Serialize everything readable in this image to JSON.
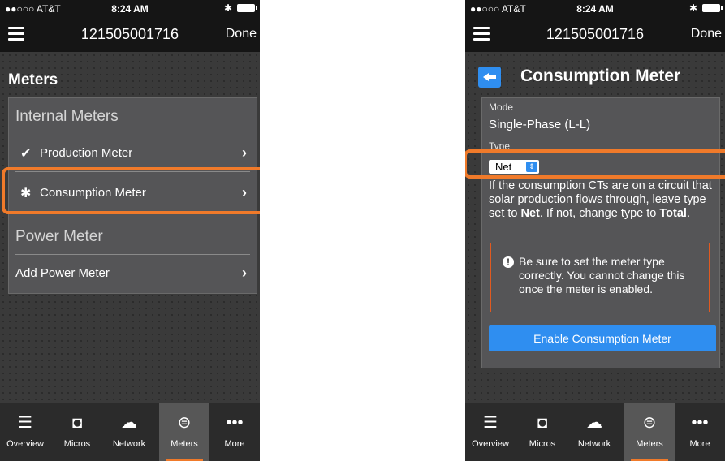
{
  "status": {
    "carrier": "●●○○○ AT&T",
    "time": "8:24 AM",
    "bluetooth": "✱"
  },
  "nav": {
    "title": "121505001716",
    "done": "Done"
  },
  "left": {
    "section_title": "Meters",
    "internal_header": "Internal Meters",
    "production_label": "Production Meter",
    "consumption_label": "Consumption Meter",
    "power_header": "Power Meter",
    "add_power_label": "Add Power Meter"
  },
  "right": {
    "title": "Consumption Meter",
    "mode_label": "Mode",
    "mode_value": "Single-Phase (L-L)",
    "type_label": "Type",
    "type_value": "Net",
    "desc_part1": "If the consumption CTs are on a circuit that solar production flows through, leave type set to ",
    "desc_net": "Net",
    "desc_part2": ". If not, change type to ",
    "desc_total": "Total",
    "desc_part3": ".",
    "warning": "Be sure to set the meter type correctly. You cannot change this once the meter is enabled.",
    "enable_button": "Enable Consumption Meter"
  },
  "tabs": [
    {
      "label": "Overview",
      "icon": "list-icon"
    },
    {
      "label": "Micros",
      "icon": "micro-icon"
    },
    {
      "label": "Network",
      "icon": "cloud-upload-icon"
    },
    {
      "label": "Meters",
      "icon": "meter-icon",
      "active": true
    },
    {
      "label": "More",
      "icon": "more-icon"
    }
  ],
  "colors": {
    "accent": "#f07a2a",
    "blue": "#2f8ef0"
  }
}
